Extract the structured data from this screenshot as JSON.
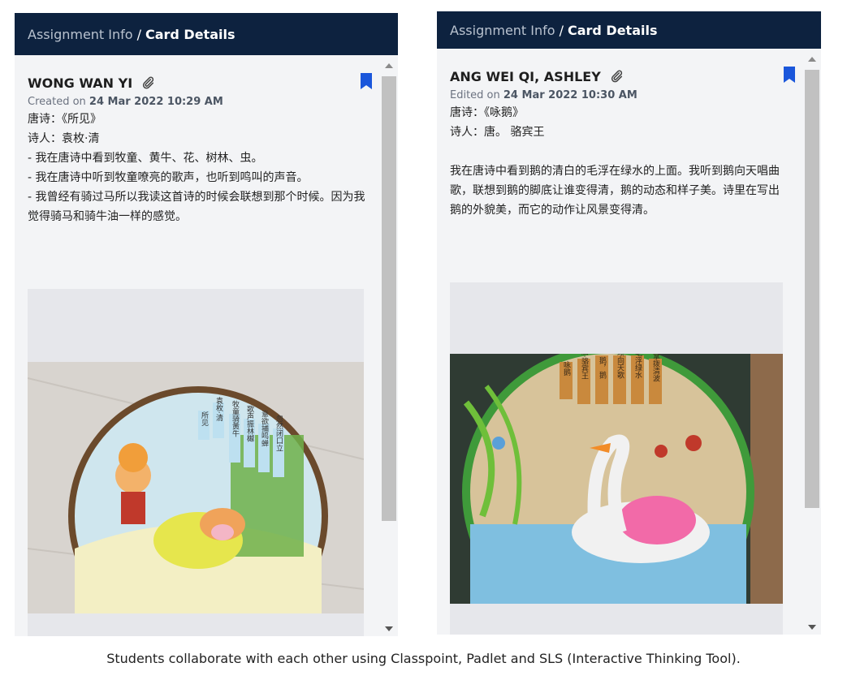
{
  "cards": [
    {
      "breadcrumb_parent": "Assignment Info",
      "breadcrumb_sep": "/",
      "breadcrumb_current": "Card Details",
      "author": "WONG WAN YI",
      "meta_prefix": "Created on",
      "meta_date": "24 Mar 2022 10:29 AM",
      "content": "唐诗：《所见》\n诗人：袁枚·清\n- 我在唐诗中看到牧童、黄牛、花、树林、虫。\n- 我在唐诗中听到牧童嘹亮的歌声，也听到鸣叫的声音。\n- 我曾经有骑过马所以我读这首诗的时候会联想到那个时候。因为我觉得骑马和骑牛油一样的感觉。",
      "photo_text": [
        "所见",
        "袁枚·清",
        "牧童骑黄牛",
        "歌声振林樾",
        "意欲捕鸣蝉",
        "忽然闭口立"
      ]
    },
    {
      "breadcrumb_parent": "Assignment Info",
      "breadcrumb_sep": "/",
      "breadcrumb_current": "Card Details",
      "author": "ANG WEI QI, ASHLEY",
      "meta_prefix": "Edited on",
      "meta_date": "24 Mar 2022 10:30 AM",
      "content": "唐诗：《咏鹅》\n诗人：唐。 骆宾王\n\n我在唐诗中看到鹅的清白的毛浮在绿水的上面。我听到鹅向天唱曲歌，联想到鹅的脚底让谁变得清，鹅的动态和样子美。诗里在写出鹅的外貌美，而它的动作让风景变得清。",
      "photo_text": [
        "咏鹅",
        "唐·骆宾王",
        "鹅，鹅，鹅",
        "曲项向天歌",
        "白毛浮绿水",
        "红掌拨清波"
      ]
    }
  ],
  "caption": "Students collaborate with each other using Classpoint, Padlet and SLS (Interactive Thinking Tool).",
  "icons": {
    "attachment": "paperclip-icon",
    "bookmark": "bookmark-icon"
  },
  "colors": {
    "header_bg": "#0d223f",
    "bookmark": "#1a56db",
    "panel_bg": "#f3f4f6"
  }
}
